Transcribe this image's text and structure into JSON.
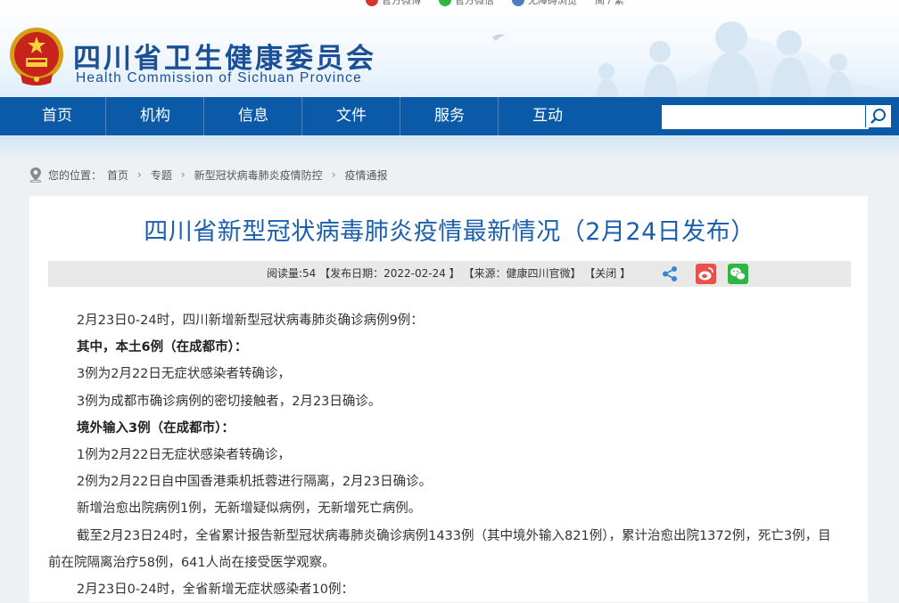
{
  "topbar": {
    "weibo": "官方微博",
    "wechat": "官方微信",
    "accessibility": "无障碍浏览",
    "lang": "简 / 繁"
  },
  "site": {
    "title": "四川省卫生健康委员会",
    "subtitle": "Health Commission of Sichuan Province"
  },
  "nav": {
    "items": [
      {
        "label": "首页"
      },
      {
        "label": "机构"
      },
      {
        "label": "信息"
      },
      {
        "label": "文件"
      },
      {
        "label": "服务"
      },
      {
        "label": "互动"
      }
    ]
  },
  "search": {
    "placeholder": ""
  },
  "breadcrumb": {
    "prefix": "您的位置：",
    "items": [
      "首页",
      "专题",
      "新型冠状病毒肺炎疫情防控",
      "疫情通报"
    ]
  },
  "article": {
    "title": "四川省新型冠状病毒肺炎疫情最新情况（2月24日发布）",
    "meta": "阅读量:54 【发布日期：2022-02-24 】 【来源：健康四川官微】 【关闭 】",
    "paragraphs": [
      {
        "text": "2月23日0-24时，四川新增新型冠状病毒肺炎确诊病例9例：",
        "bold": false
      },
      {
        "text": "其中，本土6例（在成都市）：",
        "bold": true
      },
      {
        "text": "3例为2月22日无症状感染者转确诊，",
        "bold": false
      },
      {
        "text": "3例为成都市确诊病例的密切接触者，2月23日确诊。",
        "bold": false
      },
      {
        "text": "境外输入3例（在成都市）：",
        "bold": true
      },
      {
        "text": "1例为2月22日无症状感染者转确诊，",
        "bold": false
      },
      {
        "text": "2例为2月22日自中国香港乘机抵蓉进行隔离，2月23日确诊。",
        "bold": false
      },
      {
        "text": "新增治愈出院病例1例，无新增疑似病例，无新增死亡病例。",
        "bold": false
      },
      {
        "text": "截至2月23日24时，全省累计报告新型冠状病毒肺炎确诊病例1433例（其中境外输入821例），累计治愈出院1372例，死亡3例，目前在院隔离治疗58例，641人尚在接受医学观察。",
        "bold": false
      },
      {
        "text": "2月23日0-24时，全省新增无症状感染者10例：",
        "bold": false
      }
    ]
  },
  "colors": {
    "brand": "#1b4f96",
    "nav": "#0a5aa8",
    "title": "#1b5fae"
  }
}
